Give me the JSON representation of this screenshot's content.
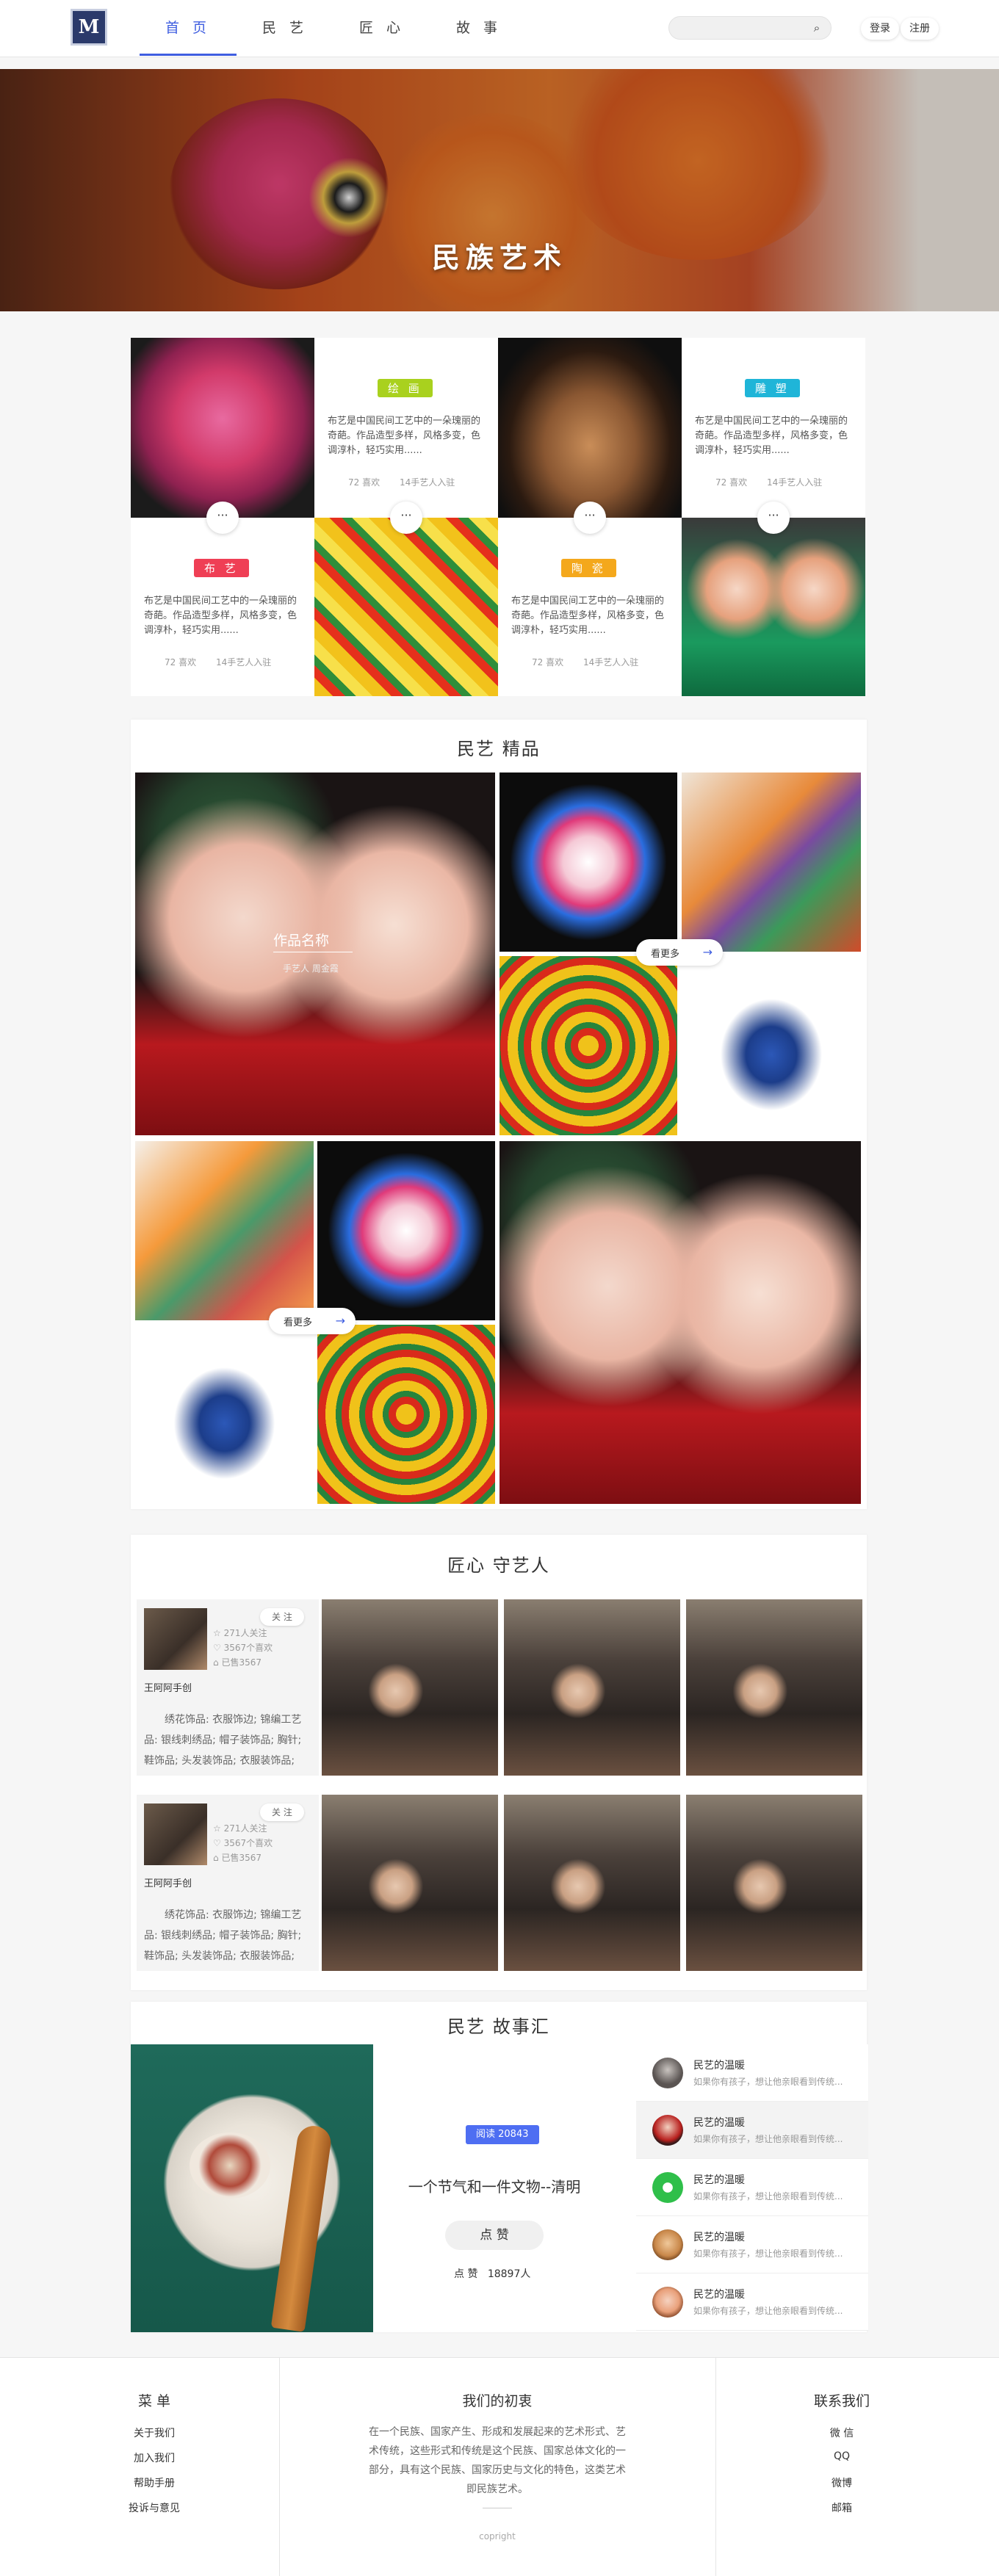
{
  "header": {
    "logo_text": "M",
    "nav": [
      "首 页",
      "民 艺",
      "匠 心",
      "故 事"
    ],
    "search_placeholder": "",
    "login": "登录",
    "register": "注册"
  },
  "hero": {
    "title": "民族艺术"
  },
  "cards": [
    {
      "tag": "绘 画",
      "tag_color": "#a9d11e",
      "desc": "布艺是中国民间工艺中的一朵瑰丽的奇葩。作品造型多样，风格多变，色调淳朴，轻巧实用......",
      "likes": "72 喜欢",
      "artisans": "14手艺人入驻"
    },
    {
      "tag": "雕 塑",
      "tag_color": "#1fb5d8",
      "desc": "布艺是中国民间工艺中的一朵瑰丽的奇葩。作品造型多样，风格多变，色调淳朴，轻巧实用......",
      "likes": "72 喜欢",
      "artisans": "14手艺人入驻"
    },
    {
      "tag": "布 艺",
      "tag_color": "#ef3f55",
      "desc": "布艺是中国民间工艺中的一朵瑰丽的奇葩。作品造型多样，风格多变，色调淳朴，轻巧实用......",
      "likes": "72 喜欢",
      "artisans": "14手艺人入驻"
    },
    {
      "tag": "陶 瓷",
      "tag_color": "#f4a81c",
      "desc": "布艺是中国民间工艺中的一朵瑰丽的奇葩。作品造型多样，风格多变，色调淳朴，轻巧实用......",
      "likes": "72 喜欢",
      "artisans": "14手艺人入驻"
    }
  ],
  "more_dots": "···",
  "works": {
    "title": "民艺 精品",
    "featured_name": "作品名称",
    "featured_author": "手艺人 周金霞",
    "view_more": "看更多"
  },
  "artisans": {
    "title": "匠心 守艺人",
    "list": [
      {
        "follow": "关 注",
        "fans": "271人关注",
        "works": "3567个喜欢",
        "bought": "已售3567",
        "name": "王阿阿手创",
        "desc": "绣花饰品: 衣服饰边; 锦编工艺品: 银线刺绣品; 帽子装饰品; 胸针; 鞋饰品; 头发装饰品; 衣服装饰品;"
      },
      {
        "follow": "关 注",
        "fans": "271人关注",
        "works": "3567个喜欢",
        "bought": "已售3567",
        "name": "王阿阿手创",
        "desc": "绣花饰品: 衣服饰边; 锦编工艺品: 银线刺绣品; 帽子装饰品; 胸针; 鞋饰品; 头发装饰品; 衣服装饰品;"
      }
    ]
  },
  "stories": {
    "title": "民艺 故事汇",
    "badge": "阅读 20843",
    "headline": "一个节气和一件文物--清明",
    "like_btn": "点 赞",
    "like_label": "点 赞",
    "like_count": "18897人",
    "items": [
      {
        "title": "民艺的温暖",
        "sub": "如果你有孩子，想让他亲眼看到传统..."
      },
      {
        "title": "民艺的温暖",
        "sub": "如果你有孩子，想让他亲眼看到传统..."
      },
      {
        "title": "民艺的温暖",
        "sub": "如果你有孩子，想让他亲眼看到传统..."
      },
      {
        "title": "民艺的温暖",
        "sub": "如果你有孩子，想让他亲眼看到传统..."
      },
      {
        "title": "民艺的温暖",
        "sub": "如果你有孩子，想让他亲眼看到传统..."
      }
    ]
  },
  "footer": {
    "menu_title": "菜 单",
    "menu": [
      "关于我们",
      "加入我们",
      "帮助手册",
      "投诉与意见"
    ],
    "mission_title": "我们的初衷",
    "mission": "在一个民族、国家产生、形成和发展起来的艺术形式、艺术传统，这些形式和传统是这个民族、国家总体文化的一部分，具有这个民族、国家历史与文化的特色，这类艺术即民族艺术。",
    "copyright": "copright",
    "contact_title": "联系我们",
    "contact": [
      "微 信",
      "QQ",
      "微博",
      "邮箱"
    ]
  }
}
